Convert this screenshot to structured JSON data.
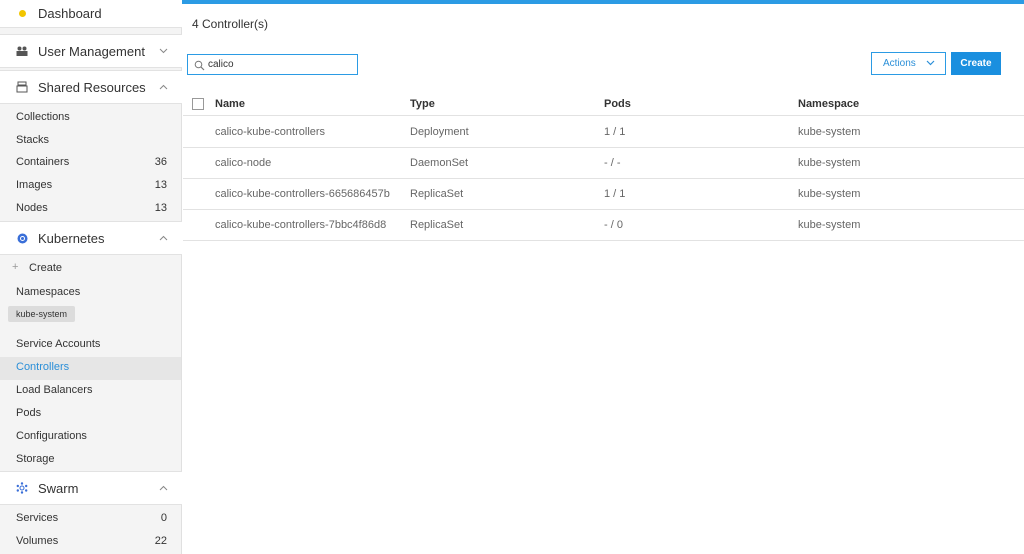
{
  "sidebar": {
    "dashboard": "Dashboard",
    "user_management": "User Management",
    "shared_resources": {
      "title": "Shared Resources",
      "items": [
        {
          "label": "Collections",
          "count": ""
        },
        {
          "label": "Stacks",
          "count": ""
        },
        {
          "label": "Containers",
          "count": "36"
        },
        {
          "label": "Images",
          "count": "13"
        },
        {
          "label": "Nodes",
          "count": "13"
        }
      ]
    },
    "kubernetes": {
      "title": "Kubernetes",
      "create": "Create",
      "namespaces": "Namespaces",
      "namespace_tag": "kube-system",
      "items": [
        {
          "label": "Service Accounts"
        },
        {
          "label": "Controllers"
        },
        {
          "label": "Load Balancers"
        },
        {
          "label": "Pods"
        },
        {
          "label": "Configurations"
        },
        {
          "label": "Storage"
        }
      ]
    },
    "swarm": {
      "title": "Swarm",
      "items": [
        {
          "label": "Services",
          "count": "0"
        },
        {
          "label": "Volumes",
          "count": "22"
        }
      ]
    }
  },
  "main": {
    "count_title": "4 Controller(s)",
    "search": {
      "value": "calico"
    },
    "actions_label": "Actions",
    "create_label": "Create",
    "columns": [
      "Name",
      "Type",
      "Pods",
      "Namespace"
    ],
    "rows": [
      {
        "name": "calico-kube-controllers",
        "type": "Deployment",
        "pods": "1 / 1",
        "namespace": "kube-system"
      },
      {
        "name": "calico-node",
        "type": "DaemonSet",
        "pods": "- / -",
        "namespace": "kube-system"
      },
      {
        "name": "calico-kube-controllers-665686457b",
        "type": "ReplicaSet",
        "pods": "1 / 1",
        "namespace": "kube-system"
      },
      {
        "name": "calico-kube-controllers-7bbc4f86d8",
        "type": "ReplicaSet",
        "pods": "- / 0",
        "namespace": "kube-system"
      }
    ]
  },
  "colors": {
    "accent": "#2b9be4",
    "dashboard_dot": "#f2c500",
    "kubernetes_icon": "#3a6fd8"
  }
}
